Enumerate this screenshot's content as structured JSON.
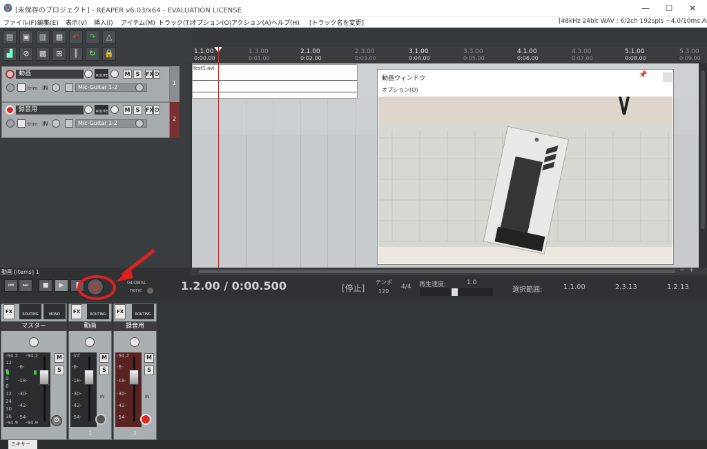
{
  "window": {
    "title": "[未保存のプロジェクト] - REAPER v6.03/x64 - EVALUATION LICENSE",
    "minimize": "—",
    "maximize": "☐",
    "close": "✕"
  },
  "menu": {
    "items": [
      "ファイル(F)",
      "編集(E)",
      "表示(V)",
      "挿入(I)",
      "アイテム(M)",
      "トラック(T)",
      "オプション(O)",
      "アクション(A)",
      "ヘルプ(H)",
      "[トラック名を変更]"
    ],
    "status": "[48kHz 24bit WAV : 6/2ch 192spls ~4.0/10ms ASIO]"
  },
  "ruler": {
    "bars": [
      {
        "bar": "1.1.00",
        "time": "0:00.00",
        "dim": false
      },
      {
        "bar": "1.3.00",
        "time": "0:01.00",
        "dim": true
      },
      {
        "bar": "2.1.00",
        "time": "0:02.00",
        "dim": false
      },
      {
        "bar": "2.3.00",
        "time": "0:03.00",
        "dim": true
      },
      {
        "bar": "3.1.00",
        "time": "0:04.00",
        "dim": false
      },
      {
        "bar": "3.3.00",
        "time": "0:05.00",
        "dim": true
      },
      {
        "bar": "4.1.00",
        "time": "0:06.00",
        "dim": false
      },
      {
        "bar": "4.3.00",
        "time": "0:07.00",
        "dim": true
      },
      {
        "bar": "5.1.00",
        "time": "0:08.00",
        "dim": false
      },
      {
        "bar": "5.3.00",
        "time": "0:09.00",
        "dim": true
      }
    ]
  },
  "tracks": [
    {
      "num": "1",
      "name": "動画",
      "trim": "trim",
      "in": "IN",
      "input": "Mic-Guitar 1-2",
      "route": "ROUTE",
      "m": "M",
      "s": "S",
      "fx": "FX"
    },
    {
      "num": "2",
      "name": "録音用",
      "trim": "trim",
      "in": "IN",
      "input": "Mic-Guitar 1-2",
      "route": "ROUTE",
      "m": "M",
      "s": "S",
      "fx": "FX"
    }
  ],
  "item": {
    "label": "test1.avi"
  },
  "video_window": {
    "title": "動画ウィンドウ",
    "menu": "オプション(O)",
    "pin": "📌"
  },
  "transport": {
    "status_line": "動画 [items] 1",
    "global_label": "GLOBAL",
    "global_value": "none",
    "time": "1.2.00 / 0:00.500",
    "state": "[停止]",
    "tempo_label": "テンポ",
    "tempo_value": "120",
    "signature": "4/4",
    "rate_label": "再生速度:",
    "rate_value": "1.0",
    "sel_label": "選択範囲:",
    "sel_start": "1.1.00",
    "sel_end": "2.3.13",
    "sel_len": "1.2.13"
  },
  "mixer": {
    "strips": [
      {
        "name": "マスター",
        "num": "",
        "routing": "ROUTING",
        "mono": "MONO",
        "peak_l": "-94.2",
        "peak_r": "-94.2",
        "bottom_l": "-94.9",
        "bottom_r": "-94.9"
      },
      {
        "name": "動画",
        "num": "1",
        "routing": "ROUTING",
        "peak": "-inf"
      },
      {
        "name": "録音用",
        "num": "2",
        "routing": "ROUTING",
        "peak": "-94.2"
      }
    ],
    "scale_master": [
      "12",
      "6",
      "0",
      "6",
      "12",
      "18",
      "24",
      "30",
      "36",
      "42"
    ],
    "scale_mid": [
      "-6-",
      "-18-",
      "-30-",
      "-42-",
      "-54-"
    ],
    "m": "M",
    "s": "S",
    "fx": "FX",
    "in": "IN",
    "tab": "ミキサー"
  },
  "colors": {
    "accent_red": "#e02020",
    "record_red": "#d9302b",
    "track_bg": "#a6abae"
  }
}
